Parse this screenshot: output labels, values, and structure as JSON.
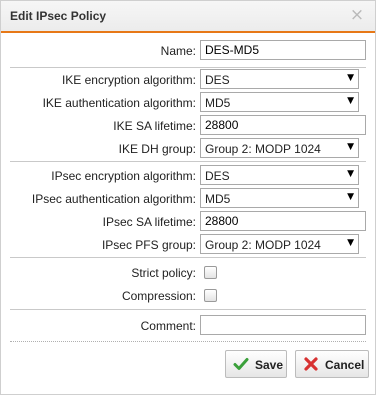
{
  "dialog": {
    "title": "Edit IPsec Policy",
    "close_icon": "×"
  },
  "form": {
    "name": {
      "label": "Name:",
      "value": "DES-MD5"
    },
    "ike_encryption": {
      "label": "IKE encryption algorithm:",
      "value": "DES"
    },
    "ike_authentication": {
      "label": "IKE authentication algorithm:",
      "value": "MD5"
    },
    "ike_sa_lifetime": {
      "label": "IKE SA lifetime:",
      "value": "28800"
    },
    "ike_dh_group": {
      "label": "IKE DH group:",
      "value": "Group 2: MODP 1024"
    },
    "ipsec_encryption": {
      "label": "IPsec encryption algorithm:",
      "value": "DES"
    },
    "ipsec_authentication": {
      "label": "IPsec authentication algorithm:",
      "value": "MD5"
    },
    "ipsec_sa_lifetime": {
      "label": "IPsec SA lifetime:",
      "value": "28800"
    },
    "ipsec_pfs_group": {
      "label": "IPsec PFS group:",
      "value": "Group 2: MODP 1024"
    },
    "strict_policy": {
      "label": "Strict policy:",
      "checked": false
    },
    "compression": {
      "label": "Compression:",
      "checked": false
    },
    "comment": {
      "label": "Comment:",
      "value": ""
    }
  },
  "buttons": {
    "save": {
      "label": "Save",
      "icon": "checkmark-icon",
      "icon_color": "#3aa03a"
    },
    "cancel": {
      "label": "Cancel",
      "icon": "x-icon",
      "icon_color": "#d83232"
    }
  },
  "colors": {
    "accent": "#e77817"
  }
}
